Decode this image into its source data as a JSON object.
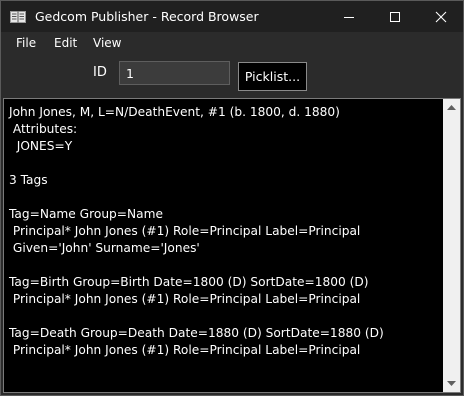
{
  "window": {
    "title": "Gedcom Publisher - Record Browser",
    "icons": {
      "app": "book-icon",
      "minimize": "minimize-icon",
      "maximize": "maximize-icon",
      "close": "close-icon"
    }
  },
  "menu": {
    "file": "File",
    "edit": "Edit",
    "view": "View"
  },
  "toolbar": {
    "id_label": "ID",
    "id_value": "1",
    "picklist_label": "Picklist..."
  },
  "record": {
    "text": "John Jones, M, L=N/DeathEvent, #1 (b. 1800, d. 1880)\n Attributes:\n  JONES=Y\n\n3 Tags\n\nTag=Name Group=Name\n Principal* John Jones (#1) Role=Principal Label=Principal\n Given='John' Surname='Jones'\n\nTag=Birth Group=Birth Date=1800 (D) SortDate=1800 (D)\n Principal* John Jones (#1) Role=Principal Label=Principal\n\nTag=Death Group=Death Date=1880 (D) SortDate=1880 (D)\n Principal* John Jones (#1) Role=Principal Label=Principal",
    "scroll_up_icon": "scroll-up-arrow-icon",
    "scroll_down_icon": "scroll-down-arrow-icon"
  },
  "colors": {
    "titlebar": "#202020",
    "window_bg": "#2b2b2b",
    "text_bg": "#000000",
    "text": "#ffffff",
    "scrollbar": "#f0f0f0"
  }
}
